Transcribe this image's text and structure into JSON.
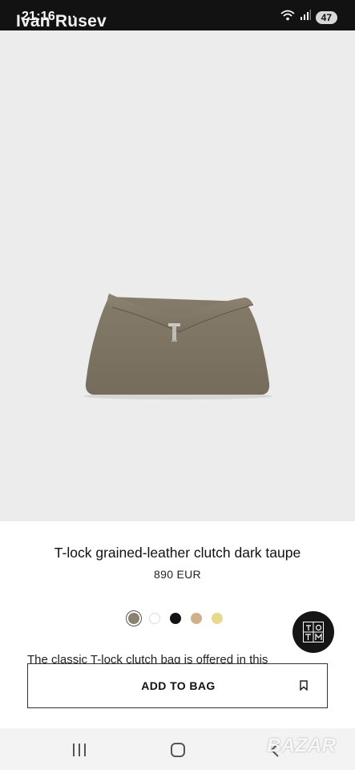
{
  "status_bar": {
    "time": "21:16",
    "notification_dots": "• •",
    "battery": "47",
    "watermark_name": "Ivan Rusev"
  },
  "product": {
    "image_icon": "dark-taupe-clutch-bag-image",
    "title": "T-lock grained-leather clutch dark taupe",
    "price": "890 EUR",
    "description": "The classic T-lock clutch bag is offered in this"
  },
  "swatches": [
    {
      "name": "dark taupe",
      "color": "#8a8170",
      "selected": true
    },
    {
      "name": "white",
      "color": "#ffffff",
      "selected": false
    },
    {
      "name": "black",
      "color": "#121212",
      "selected": false
    },
    {
      "name": "tan",
      "color": "#cfb088",
      "selected": false
    },
    {
      "name": "butter yellow",
      "color": "#e8d98e",
      "selected": false
    }
  ],
  "monogram": {
    "icon": "toteme-monogram-icon"
  },
  "cta": {
    "add_to_bag": "ADD TO BAG",
    "bookmark_icon": "bookmark-icon"
  },
  "nav": {
    "recent_icon": "recent-apps-icon",
    "home_icon": "home-icon",
    "back_icon": "back-icon"
  },
  "watermark_logo": "BAZAR"
}
